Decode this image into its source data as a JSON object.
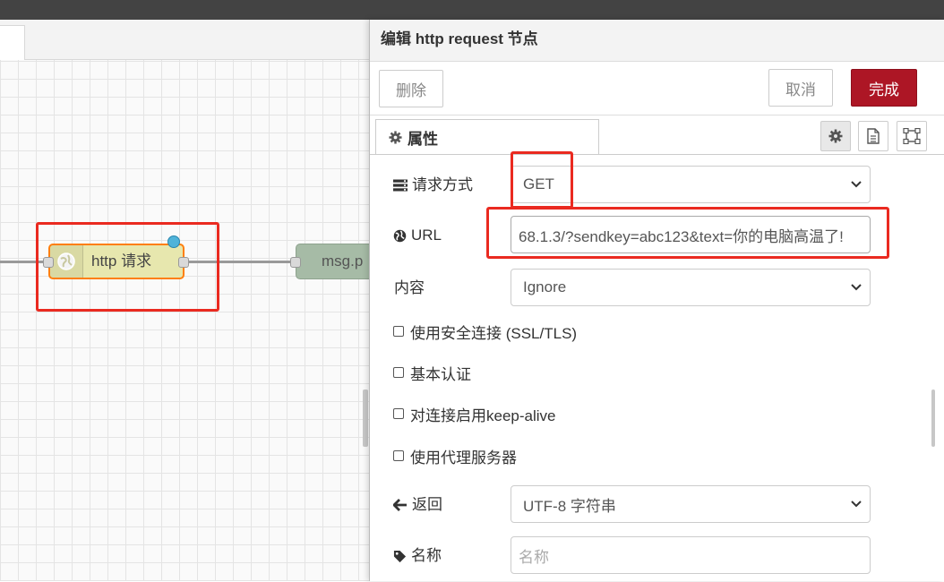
{
  "canvas": {
    "nodes": {
      "http_request_label": "http 请求",
      "debug_label": "msg.p"
    }
  },
  "tray": {
    "title": "编辑 http request 节点",
    "buttons": {
      "delete": "删除",
      "cancel": "取消",
      "done": "完成"
    },
    "tabs": {
      "properties": "属性"
    },
    "form": {
      "method": {
        "label": "请求方式",
        "value": "GET"
      },
      "url": {
        "label": "URL",
        "value": "68.1.3/?sendkey=abc123&text=你的电脑高温了!"
      },
      "payload": {
        "label": "内容",
        "value": "Ignore"
      },
      "checkboxes": [
        {
          "label": "使用安全连接 (SSL/TLS)",
          "checked": false
        },
        {
          "label": "基本认证",
          "checked": false
        },
        {
          "label": "对连接启用keep-alive",
          "checked": false
        },
        {
          "label": "使用代理服务器",
          "checked": false
        }
      ],
      "return": {
        "label": "返回",
        "value": "UTF-8 字符串"
      },
      "name": {
        "label": "名称",
        "placeholder": "名称",
        "value": ""
      }
    }
  },
  "colors": {
    "accent_done": "#ad1625",
    "highlight": "#ea2a20",
    "http_node_fill": "#e7e7ae",
    "http_node_border": "#ff7f0e",
    "status_dot": "#4fb3d9",
    "debug_node_fill": "#a6bba6"
  },
  "icons": {
    "properties_tab": "gear-icon",
    "method": "list-icon",
    "url": "globe-icon",
    "return": "arrow-left-icon",
    "name": "tag-icon",
    "http_node": "globe-icon"
  }
}
